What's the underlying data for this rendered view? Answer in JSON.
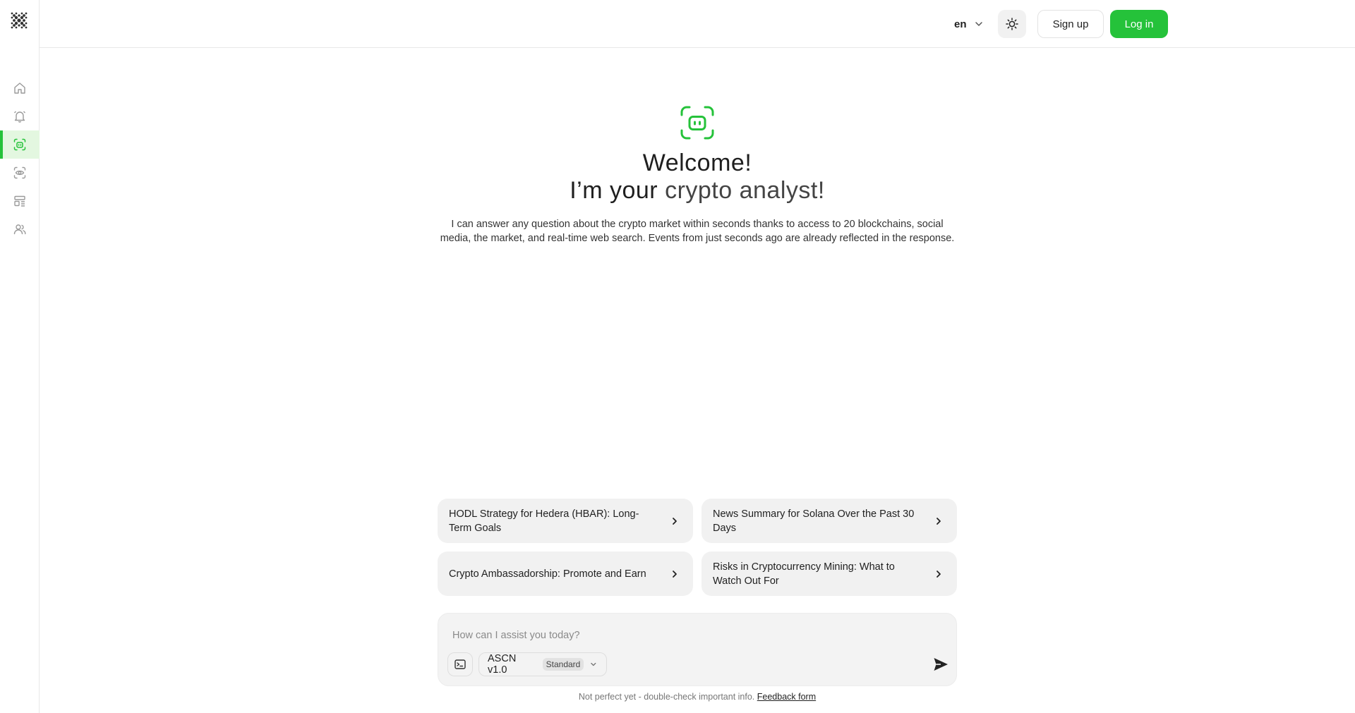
{
  "sidebar": {
    "logo": "dot-grid-logo",
    "items": [
      {
        "icon": "home-icon",
        "active": false
      },
      {
        "icon": "bell-icon",
        "active": false
      },
      {
        "icon": "robot-scan-icon",
        "active": true
      },
      {
        "icon": "eye-scan-icon",
        "active": false
      },
      {
        "icon": "layout-icon",
        "active": false
      },
      {
        "icon": "users-icon",
        "active": false
      }
    ]
  },
  "header": {
    "language": "en",
    "theme_icon": "sun-icon",
    "signup_label": "Sign up",
    "login_label": "Log in"
  },
  "hero": {
    "icon": "robot-scan-icon",
    "title_line1": "Welcome!",
    "title_line2_prefix": "I’m your ",
    "title_line2_accent": "crypto analyst!",
    "description": "I can answer any question about the crypto market within seconds thanks to access to 20 blockchains, social media, the market, and real-time web search. Events from just seconds ago are already reflected in the response."
  },
  "suggestions": [
    "HODL Strategy for Hedera (HBAR): Long-Term Goals",
    "News Summary for Solana Over the Past 30 Days",
    "Crypto Ambassadorship: Promote and Earn",
    "Risks in Cryptocurrency Mining: What to Watch Out For"
  ],
  "composer": {
    "placeholder": "How can I assist you today?",
    "value": "",
    "model_name": "ASCN v1.0",
    "model_tier": "Standard"
  },
  "footer": {
    "note": "Not perfect yet - double-check important info.",
    "feedback_link": "Feedback form"
  },
  "colors": {
    "accent": "#25c23a",
    "active_bg": "#e3f7e0"
  }
}
